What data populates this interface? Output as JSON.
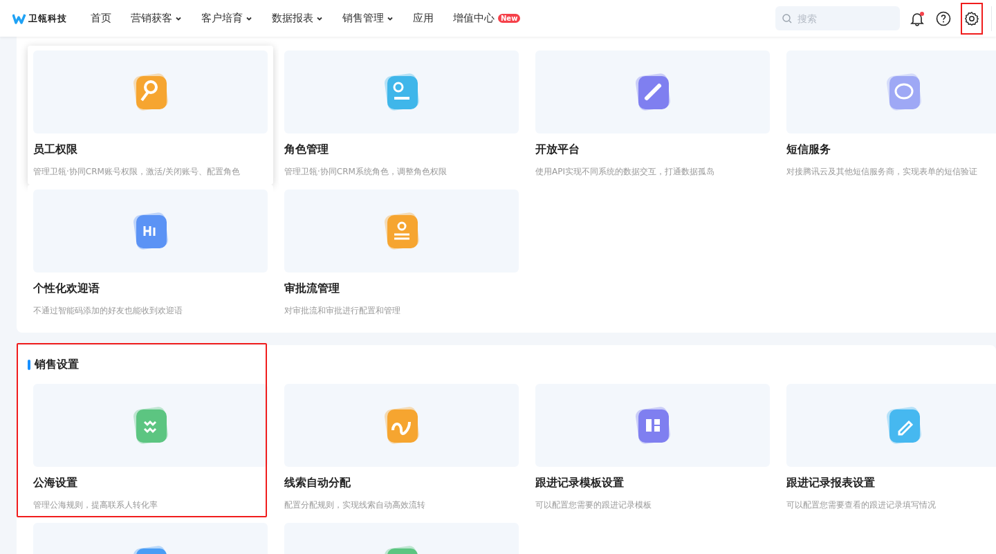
{
  "header": {
    "logo": "卫瓴科技",
    "nav": [
      {
        "label": "首页",
        "dropdown": false
      },
      {
        "label": "营销获客",
        "dropdown": true
      },
      {
        "label": "客户培育",
        "dropdown": true
      },
      {
        "label": "数据报表",
        "dropdown": true
      },
      {
        "label": "销售管理",
        "dropdown": true
      },
      {
        "label": "应用",
        "dropdown": false
      },
      {
        "label": "增值中心",
        "dropdown": false,
        "badge": "New"
      }
    ],
    "search": {
      "placeholder": "搜索"
    },
    "notification_dot": true,
    "settings_highlighted": true
  },
  "sections": [
    {
      "highlighted": false,
      "cards": [
        {
          "title": "员工权限",
          "description": "管理卫瓴·协同CRM账号权限，激活/关闭账号、配置角色",
          "color": "#f6a530",
          "hovered": true
        },
        {
          "title": "角色管理",
          "description": "管理卫瓴·协同CRM系统角色，调整角色权限",
          "color": "#3fb6ea",
          "hovered": false
        },
        {
          "title": "开放平台",
          "description": "使用API实现不同系统的数据交互，打通数据孤岛",
          "color": "#7f7ff0",
          "hovered": false
        },
        {
          "title": "短信服务",
          "description": "对接腾讯云及其他短信服务商，实现表单的短信验证",
          "color": "#9ea8f5",
          "hovered": false
        },
        {
          "title": "个性化欢迎语",
          "description": "不通过智能码添加的好友也能收到欢迎语",
          "color": "#5b93f5",
          "hovered": false
        },
        {
          "title": "审批流管理",
          "description": "对审批流和审批进行配置和管理",
          "color": "#f6a530",
          "hovered": false
        }
      ]
    },
    {
      "title": "销售设置",
      "highlighted": true,
      "cards": [
        {
          "title": "公海设置",
          "description": "管理公海规则，提高联系人转化率",
          "color": "#5cc581",
          "hovered": false
        },
        {
          "title": "线索自动分配",
          "description": "配置分配规则，实现线索自动高效流转",
          "color": "#f6a530",
          "hovered": false
        },
        {
          "title": "跟进记录模板设置",
          "description": "可以配置您需要的跟进记录模板",
          "color": "#7f7ff0",
          "hovered": false
        },
        {
          "title": "跟进记录报表设置",
          "description": "可以配置您需要查看的跟进记录填写情况",
          "color": "#46b8f0",
          "hovered": false
        },
        {
          "color": "#4a9df5",
          "hovered": false
        },
        {
          "color": "#5cc581",
          "hovered": false
        }
      ]
    }
  ]
}
